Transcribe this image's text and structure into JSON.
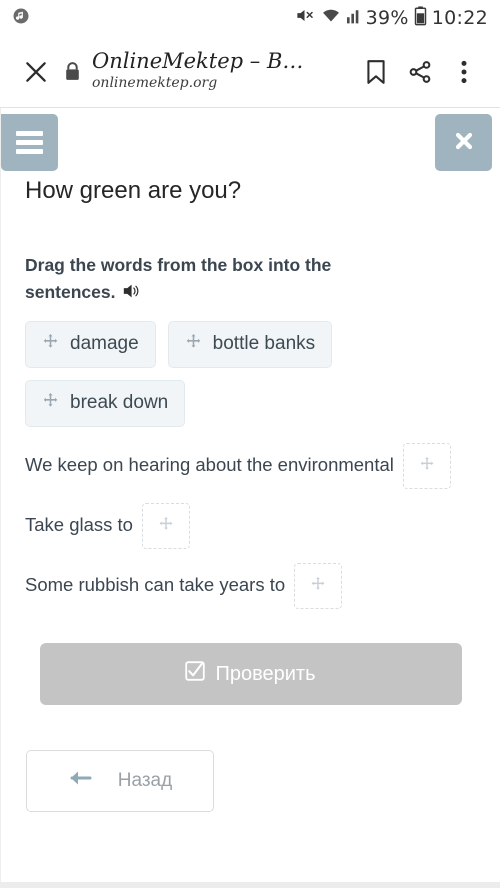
{
  "status_bar": {
    "notification_icon": "music-note-icon",
    "mute_icon": "volume-muted-icon",
    "wifi_icon": "wifi-icon",
    "signal_icon": "cell-signal-icon",
    "battery_percent": "39%",
    "battery_icon": "battery-icon",
    "time": "10:22"
  },
  "browser": {
    "close_icon": "close-icon",
    "lock_icon": "lock-icon",
    "title": "OnlineMektep – В…",
    "url": "onlinemektep.org",
    "bookmark_icon": "bookmark-icon",
    "share_icon": "share-icon",
    "more_icon": "overflow-menu-icon"
  },
  "page": {
    "menu_button_icon": "hamburger-menu-icon",
    "close_button_icon": "close-icon",
    "lesson_title": "How green are you?",
    "instruction": "Drag the words from the box into the sentences.",
    "audio_icon": "speaker-icon",
    "word_chips": [
      {
        "label": "damage",
        "icon": "move-arrows-icon"
      },
      {
        "label": "bottle banks",
        "icon": "move-arrows-icon"
      },
      {
        "label": "break down",
        "icon": "move-arrows-icon"
      }
    ],
    "sentences": [
      {
        "text": "We keep on hearing about the environmental",
        "blank_value": "",
        "blank_icon": "move-arrows-icon",
        "blank_after": true
      },
      {
        "text": "Take glass to",
        "blank_value": "",
        "blank_icon": "move-arrows-icon",
        "blank_after": true
      },
      {
        "text": "Some rubbish can take years to",
        "blank_value": "",
        "blank_icon": "move-arrows-icon",
        "blank_after": true
      }
    ],
    "check_button": {
      "label": "Проверить",
      "icon": "checkbox-checked-icon",
      "disabled": true
    },
    "back_button": {
      "label": "Назад",
      "icon": "arrow-left-icon"
    }
  },
  "colors": {
    "accent_blue_gray": "#9fb4be",
    "chip_bg": "#f1f5f8",
    "disabled_button": "#c4c4c4",
    "text_dark": "#3b4650"
  }
}
